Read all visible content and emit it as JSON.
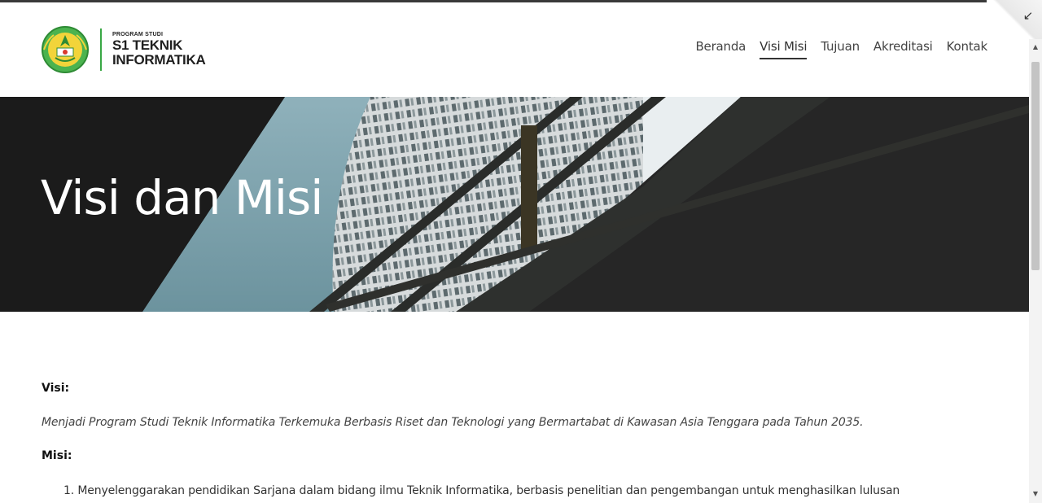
{
  "header": {
    "logo": {
      "small_text": "PROGRAM STUDI",
      "line1": "S1 TEKNIK",
      "line2": "INFORMATIKA"
    },
    "nav": [
      {
        "label": "Beranda",
        "active": false
      },
      {
        "label": "Visi Misi",
        "active": true
      },
      {
        "label": "Tujuan",
        "active": false
      },
      {
        "label": "Akreditasi",
        "active": false
      },
      {
        "label": "Kontak",
        "active": false
      }
    ]
  },
  "hero": {
    "title": "Visi dan Misi"
  },
  "content": {
    "visi_label": "Visi:",
    "visi_text": "Menjadi Program Studi Teknik Informatika Terkemuka Berbasis Riset dan Teknologi yang Bermartabat di Kawasan Asia Tenggara pada Tahun 2035.",
    "misi_label": "Misi:",
    "misi_items": [
      "1. Menyelenggarakan pendidikan Sarjana dalam bidang ilmu Teknik Informatika, berbasis penelitian dan pengembangan untuk menghasilkan lulusan"
    ]
  },
  "icons": {
    "collapse": "arrow-down-left-icon",
    "scroll_up": "scroll-up-arrow-icon",
    "scroll_down": "scroll-down-arrow-icon"
  },
  "colors": {
    "brand_green": "#39a845",
    "hero_dark": "#1c1c1c",
    "sky": "#7ba0ab"
  }
}
